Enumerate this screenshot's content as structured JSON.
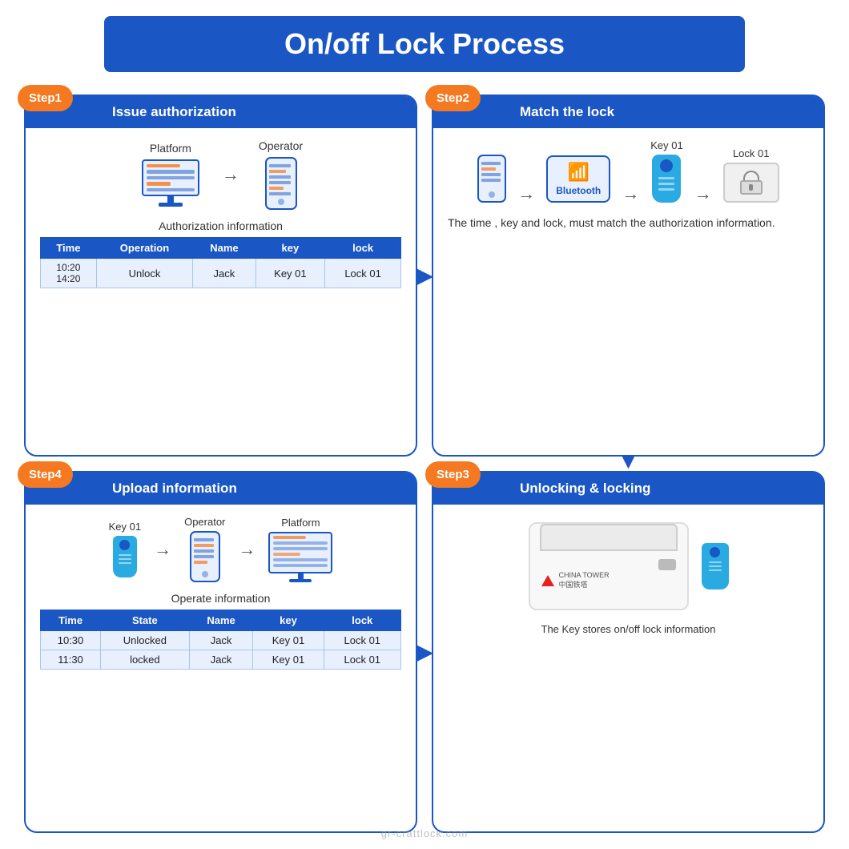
{
  "page": {
    "title": "On/off Lock Process",
    "watermark": "gr-crattlock.com"
  },
  "step1": {
    "badge": "Step1",
    "header": "Issue authorization",
    "platform_label": "Platform",
    "operator_label": "Operator",
    "auth_section_label": "Authorization information",
    "table_headers": [
      "Time",
      "Operation",
      "Name",
      "key",
      "lock"
    ],
    "table_rows": [
      {
        "time": "10:20\n14:20",
        "operation": "Unlock",
        "name": "Jack",
        "key": "Key 01",
        "lock": "Lock 01"
      }
    ]
  },
  "step2": {
    "badge": "Step2",
    "header": "Match the lock",
    "key_label": "Key 01",
    "lock_label": "Lock 01",
    "bluetooth_label": "Bluetooth",
    "description": "The time , key and lock, must match the authorization information."
  },
  "step3": {
    "badge": "Step3",
    "header": "Unlocking &  locking",
    "description": "The Key stores on/off lock information"
  },
  "step4": {
    "badge": "Step4",
    "header": "Upload information",
    "key_label": "Key 01",
    "operator_label": "Operator",
    "platform_label": "Platform",
    "operate_section_label": "Operate information",
    "table_headers": [
      "Time",
      "State",
      "Name",
      "key",
      "lock"
    ],
    "table_rows": [
      {
        "time": "10:30",
        "state": "Unlocked",
        "name": "Jack",
        "key": "Key 01",
        "lock": "Lock 01"
      },
      {
        "time": "11:30",
        "state": "locked",
        "name": "Jack",
        "key": "Key 01",
        "lock": "Lock 01"
      }
    ]
  },
  "arrows": {
    "right": "▶",
    "down": "▼",
    "left": "◀"
  }
}
